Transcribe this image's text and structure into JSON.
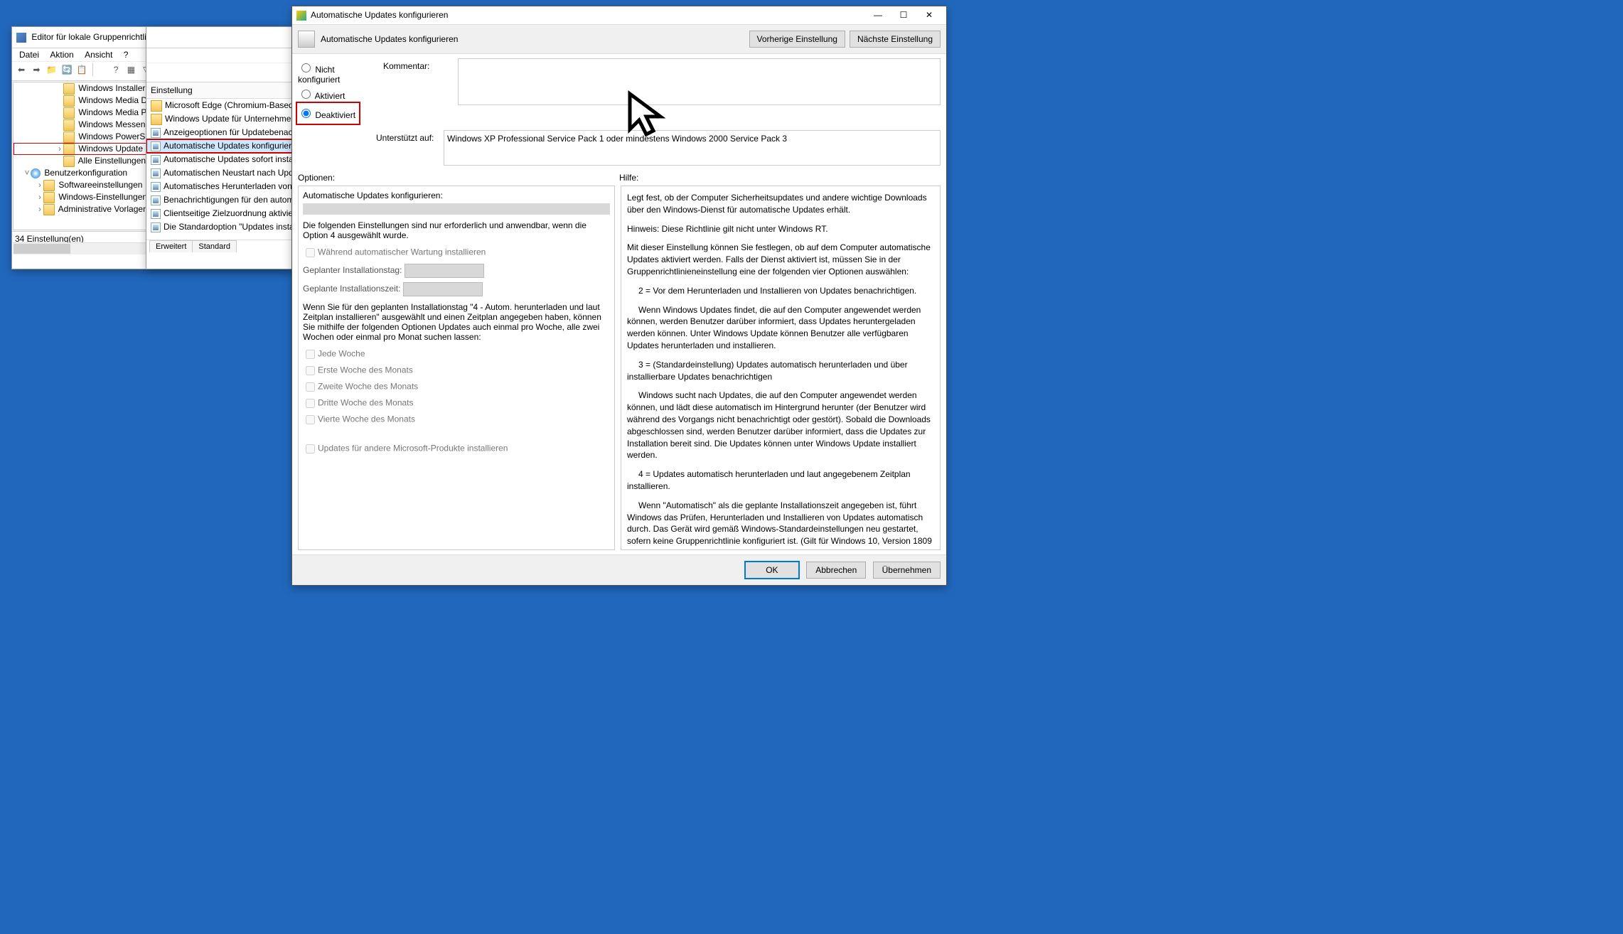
{
  "gpedit": {
    "title": "Editor für lokale Gruppenrichtlinien",
    "menu": {
      "datei": "Datei",
      "aktion": "Aktion",
      "ansicht": "Ansicht",
      "hilfe": "?"
    },
    "tree": [
      {
        "label": "Windows Installer",
        "indent": 60
      },
      {
        "label": "Windows Media Digital Rights Manag",
        "indent": 60
      },
      {
        "label": "Windows Media Player",
        "indent": 60
      },
      {
        "label": "Windows Messenger",
        "indent": 60
      },
      {
        "label": "Windows PowerShell",
        "indent": 60
      },
      {
        "label": "Windows Update",
        "indent": 60,
        "sel": true,
        "exp": ">"
      },
      {
        "label": "Alle Einstellungen",
        "indent": 60
      },
      {
        "label": "Benutzerkonfiguration",
        "indent": 14,
        "user": true,
        "exp": "v"
      },
      {
        "label": "Softwareeinstellungen",
        "indent": 32,
        "exp": ">"
      },
      {
        "label": "Windows-Einstellungen",
        "indent": 32,
        "exp": ">"
      },
      {
        "label": "Administrative Vorlagen",
        "indent": 32,
        "exp": ">"
      }
    ],
    "status": "34 Einstellung(en)"
  },
  "list": {
    "header": "Einstellung",
    "items": [
      "Microsoft Edge (Chromium-Based) Blockers",
      "Windows Update für Unternehmen",
      "Anzeigeoptionen für Updatebenachrichtigungen",
      "Automatische Updates konfigurieren",
      "Automatische Updates sofort installieren",
      "Automatischen Neustart nach Updates während der Nutzun",
      "Automatisches Herunterladen von Updates über getaktete V",
      "Benachrichtigungen für den automatischen Neustart zur Up",
      "Clientseitige Zielzuordnung aktivieren",
      "Die Standardoption \"Updates installieren und herunterfahre"
    ],
    "sel_index": 3,
    "tabs": {
      "erweitert": "Erweitert",
      "standard": "Standard"
    }
  },
  "dialog": {
    "title": "Automatische Updates konfigurieren",
    "subtitle": "Automatische Updates konfigurieren",
    "nav": {
      "prev": "Vorherige Einstellung",
      "next": "Nächste Einstellung"
    },
    "radios": {
      "nk": "Nicht konfiguriert",
      "ak": "Aktiviert",
      "de": "Deaktiviert"
    },
    "labels": {
      "kommentar": "Kommentar:",
      "unterstuetzt": "Unterstützt auf:",
      "optionen": "Optionen:",
      "hilfe": "Hilfe:"
    },
    "supported": "Windows XP Professional Service Pack 1 oder mindestens Windows 2000 Service Pack 3",
    "options": {
      "head": "Automatische Updates konfigurieren:",
      "note": "Die folgenden Einstellungen sind nur erforderlich und anwendbar, wenn die Option 4 ausgewählt wurde.",
      "maint": "Während automatischer Wartung installieren",
      "day": "Geplanter Installationstag:",
      "time": "Geplante Installationszeit:",
      "explain": "Wenn Sie für den geplanten Installationstag \"4 - Autom. herunterladen und laut Zeitplan installieren\" ausgewählt und einen Zeitplan angegeben haben, können Sie mithilfe der folgenden Optionen Updates auch einmal pro Woche, alle zwei Wochen oder einmal pro Monat suchen lassen:",
      "w1": "Jede Woche",
      "w2": "Erste Woche des Monats",
      "w3": "Zweite Woche des Monats",
      "w4": "Dritte Woche des Monats",
      "w5": "Vierte Woche des Monats",
      "ms": "Updates für andere Microsoft-Produkte installieren"
    },
    "help": {
      "p1": "Legt fest, ob der Computer Sicherheitsupdates und andere wichtige Downloads über den Windows-Dienst für automatische Updates erhält.",
      "p2": "Hinweis: Diese Richtlinie gilt nicht unter Windows RT.",
      "p3": "Mit dieser Einstellung können Sie festlegen, ob auf dem Computer automatische Updates aktiviert werden. Falls der Dienst aktiviert ist, müssen Sie in der Gruppenrichtlinieneinstellung eine der folgenden vier Optionen auswählen:",
      "p4": "2 = Vor dem Herunterladen und Installieren von Updates benachrichtigen.",
      "p5": "Wenn Windows Updates findet, die auf den Computer angewendet werden können, werden Benutzer darüber informiert, dass Updates heruntergeladen werden können. Unter Windows Update können Benutzer alle verfügbaren Updates herunterladen und installieren.",
      "p6": "3 = (Standardeinstellung) Updates automatisch herunterladen und über installierbare Updates benachrichtigen",
      "p7": "Windows sucht nach Updates, die auf den Computer angewendet werden können, und lädt diese automatisch im Hintergrund herunter (der Benutzer wird während des Vorgangs nicht benachrichtigt oder gestört). Sobald die Downloads abgeschlossen sind, werden Benutzer darüber informiert, dass die Updates zur Installation bereit sind. Die Updates können unter Windows Update installiert werden.",
      "p8": "4 = Updates automatisch herunterladen und laut angegebenem Zeitplan installieren.",
      "p9": "Wenn \"Automatisch\" als die geplante Installationszeit angegeben ist, führt Windows das Prüfen, Herunterladen und Installieren von Updates automatisch durch. Das Gerät wird gemäß Windows-Standardeinstellungen neu gestartet, sofern keine Gruppenrichtlinie konfiguriert ist. (Gilt für Windows 10, Version 1809"
    },
    "buttons": {
      "ok": "OK",
      "cancel": "Abbrechen",
      "apply": "Übernehmen"
    }
  }
}
